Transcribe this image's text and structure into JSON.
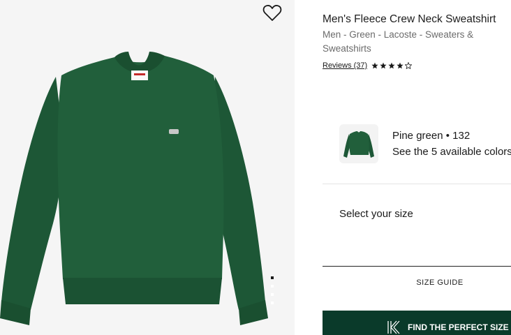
{
  "product": {
    "title": "Men's Fleece Crew Neck Sweatshirt",
    "breadcrumb": "Men - Green - Lacoste - Sweaters & Sweatshirts",
    "reviews_label": "Reviews (37)",
    "rating": 4,
    "rating_max": 5
  },
  "color": {
    "name": "Pine green • 132",
    "available_link": "See the 5 available colors",
    "swatch_color": "#1f5a39"
  },
  "size": {
    "select_label": "Select your size",
    "size_guide_label": "SIZE GUIDE"
  },
  "cta": {
    "perfect_size_label": "FIND THE PERFECT SIZE",
    "background": "#0a3a2a"
  },
  "gallery": {
    "sweatshirt_color": "#1f5a39",
    "image_count": 4
  },
  "icons": {
    "wishlist": "heart-outline-icon",
    "star": "star-icon",
    "kiwi_logo": "kiwisizing-logo-icon"
  }
}
